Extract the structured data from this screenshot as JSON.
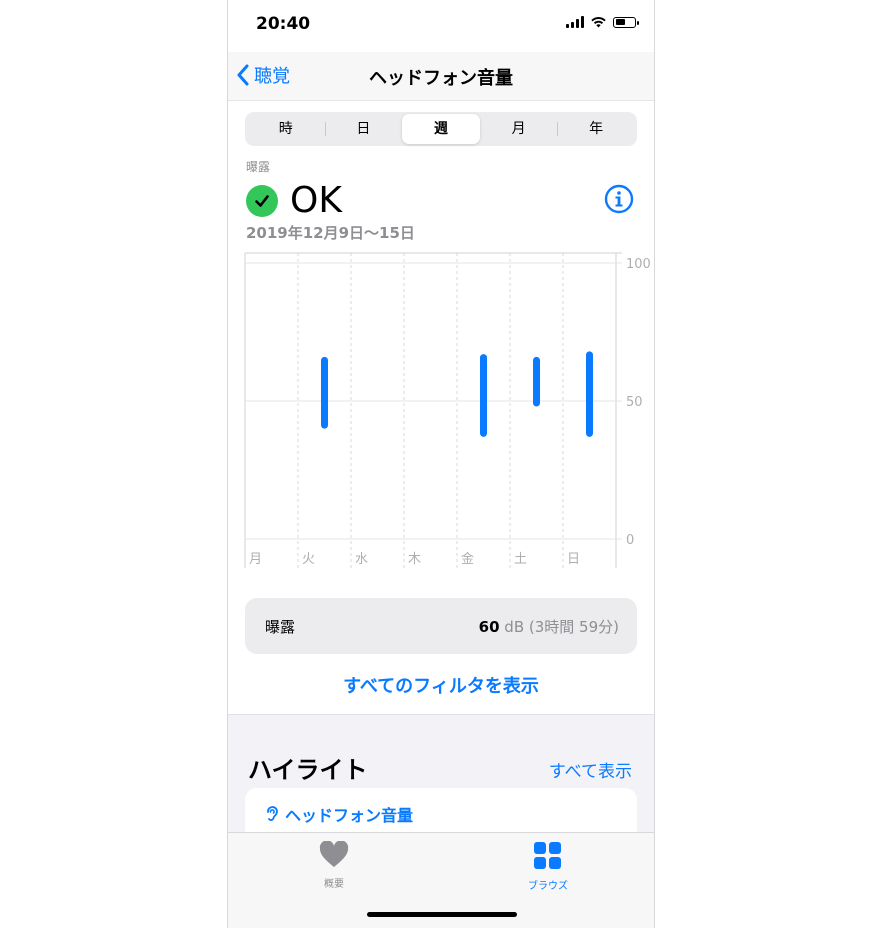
{
  "status_bar": {
    "time": "20:40"
  },
  "nav": {
    "back_label": "聴覚",
    "title": "ヘッドフォン音量"
  },
  "segments": [
    "時",
    "日",
    "週",
    "月",
    "年"
  ],
  "selected_segment": "週",
  "exposure": {
    "label": "曝露",
    "status": "OK",
    "date_range": "2019年12月9日〜15日"
  },
  "chart_data": {
    "type": "range-bar",
    "categories": [
      "月",
      "火",
      "水",
      "木",
      "金",
      "土",
      "日"
    ],
    "ranges": [
      null,
      [
        40,
        66
      ],
      null,
      null,
      [
        37,
        67
      ],
      [
        48,
        66
      ],
      [
        37,
        68
      ]
    ],
    "y_ticks": [
      "100",
      "50",
      "0"
    ],
    "ylim": [
      0,
      100
    ],
    "color": "#0a7aff"
  },
  "summary": {
    "label": "曝露",
    "value": "60",
    "unit": "dB",
    "duration": "(3時間 59分)"
  },
  "filters_link": "すべてのフィルタを表示",
  "highlights": {
    "title": "ハイライト",
    "show_all": "すべて表示",
    "card_label": "ヘッドフォン音量"
  },
  "tabbar": {
    "summary_label": "概要",
    "browse_label": "ブラウズ"
  },
  "colors": {
    "accent": "#0a7aff",
    "ok_green": "#33c759"
  }
}
